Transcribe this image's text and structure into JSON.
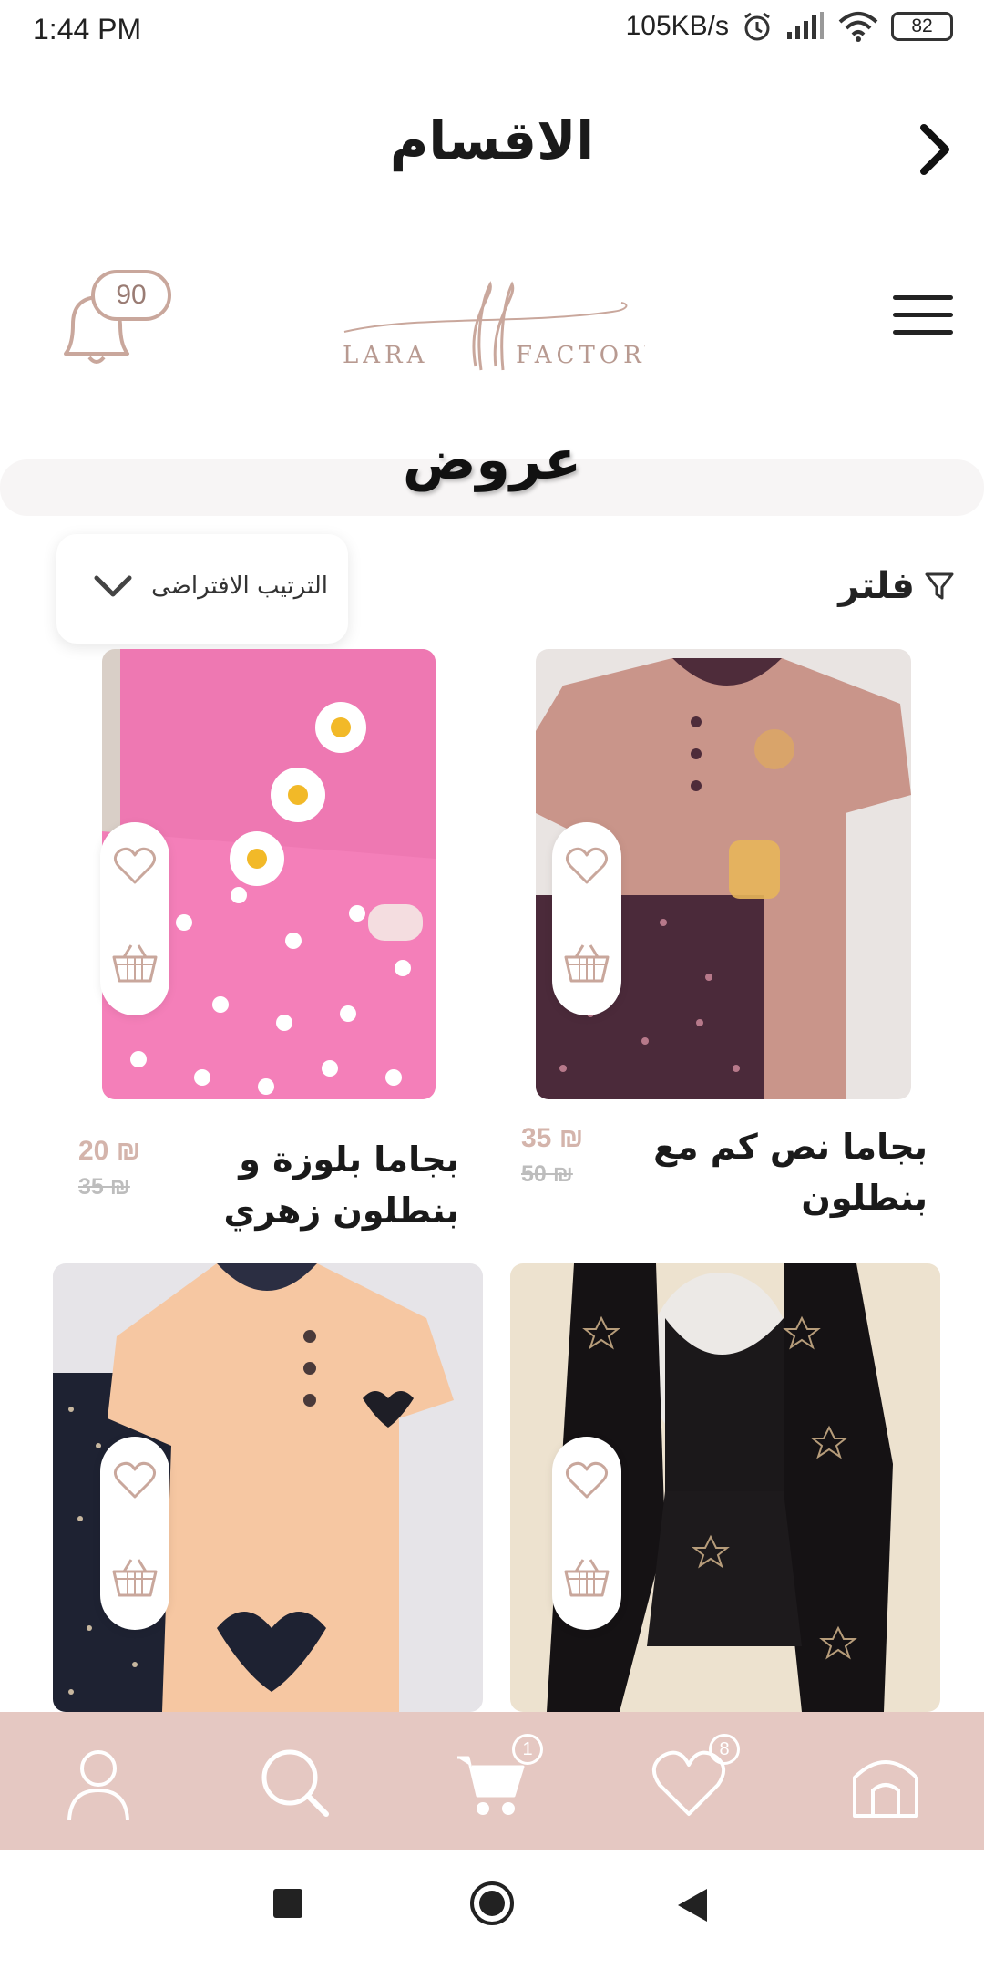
{
  "status": {
    "time": "1:44 PM",
    "speed": "105KB/s",
    "battery": "82"
  },
  "header": {
    "title": "الاقسام"
  },
  "brand": {
    "logo_text_left": "LARA",
    "logo_text_right": "FACTORY",
    "notification_count": "90"
  },
  "section": {
    "title": "عروض"
  },
  "toolbar": {
    "sort_label": "الترتيب الافتراضى",
    "filter_label": "فلتر"
  },
  "products": [
    {
      "name_line1": "بجاما نص كم مع",
      "name_line2": "بنطلون",
      "price": "35 ₪",
      "old_price": "50 ₪"
    },
    {
      "name_line1": "بجاما بلوزة و",
      "name_line2": "بنطلون زهري",
      "price": "20 ₪",
      "old_price": "35 ₪"
    },
    {
      "name_line1": "",
      "name_line2": "",
      "price": "",
      "old_price": ""
    },
    {
      "name_line1": "",
      "name_line2": "",
      "price": "",
      "old_price": ""
    }
  ],
  "nav": {
    "cart_badge": "1",
    "favorites_badge": "8"
  },
  "colors": {
    "accent": "#e5c8c2",
    "price": "#d4b4ab",
    "icon": "#c9a79c"
  }
}
